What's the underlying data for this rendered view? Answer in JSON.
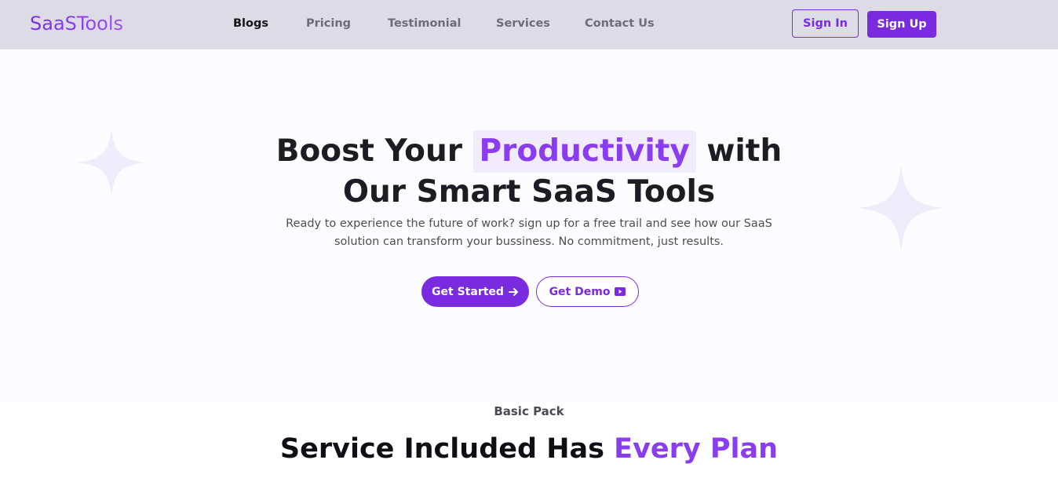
{
  "brand": {
    "logo_text": "SaaSTools",
    "accent_color": "#7a2be0",
    "highlight_color": "#8a3cf0"
  },
  "nav": {
    "links": [
      {
        "label": "Blogs",
        "active": true
      },
      {
        "label": "Pricing",
        "active": false
      },
      {
        "label": "Testimonial",
        "active": false
      },
      {
        "label": "Services",
        "active": false
      },
      {
        "label": "Contact Us",
        "active": false
      }
    ],
    "sign_in_label": "Sign In",
    "sign_up_label": "Sign Up"
  },
  "hero": {
    "title_prefix": "Boost Your",
    "title_highlight": "Productivity",
    "title_suffix": "with",
    "title_line2": "Our Smart SaaS Tools",
    "subtitle_line1": "Ready to experience the future of work? sign up for a free trail and see how our SaaS",
    "subtitle_line2": "solution can transform your bussiness. No commitment, just results.",
    "get_started_label": "Get Started",
    "get_started_icon": "arrow-right-icon",
    "get_demo_label": "Get Demo",
    "get_demo_icon": "video-play-icon"
  },
  "services": {
    "eyebrow": "Basic Pack",
    "title_prefix": "Service Included Has",
    "title_accent": "Every Plan"
  }
}
